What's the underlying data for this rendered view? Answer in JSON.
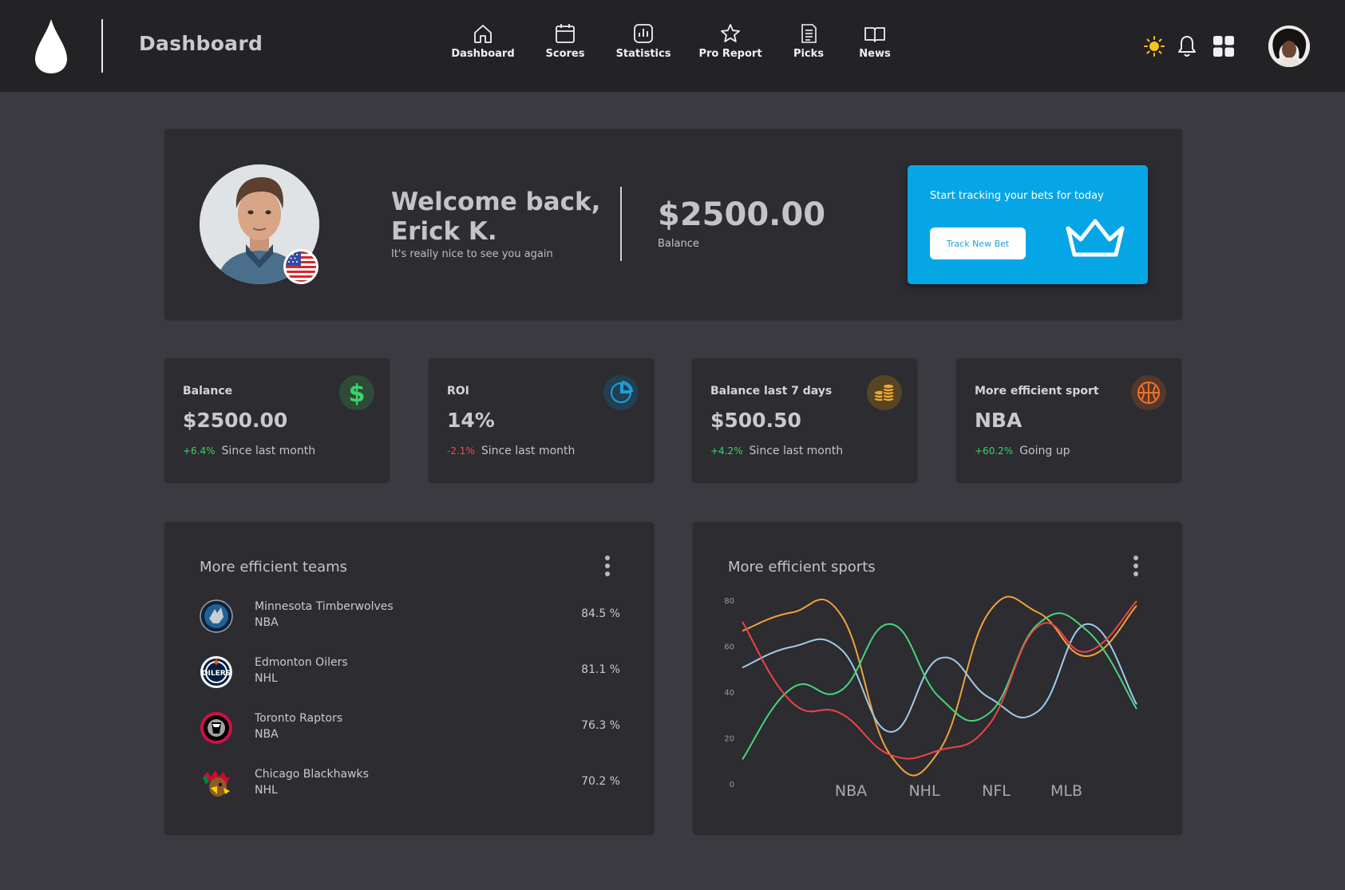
{
  "header": {
    "title": "Dashboard",
    "nav": [
      {
        "label": "Dashboard",
        "icon": "home-icon"
      },
      {
        "label": "Scores",
        "icon": "calendar-icon"
      },
      {
        "label": "Statistics",
        "icon": "bar-chart-icon"
      },
      {
        "label": "Pro Report",
        "icon": "star-icon"
      },
      {
        "label": "Picks",
        "icon": "document-icon"
      },
      {
        "label": "News",
        "icon": "book-icon"
      }
    ],
    "right_icons": [
      "sun-icon",
      "bell-icon",
      "apps-grid-icon"
    ]
  },
  "welcome": {
    "title": "Welcome back, Erick K.",
    "subtitle": "It's really nice to see you again",
    "balance": "$2500.00",
    "balance_label": "Balance",
    "cta_text": "Start tracking your bets for today",
    "cta_button": "Track New Bet"
  },
  "stats": [
    {
      "label": "Balance",
      "value": "$2500.00",
      "change": "+6.4%",
      "note": "Since last month",
      "icon": "dollar-icon",
      "color": "#39d36b"
    },
    {
      "label": "ROI",
      "value": "14%",
      "change": "-2.1%",
      "note": "Since last month",
      "icon": "pie-chart-icon",
      "color": "#1f9fdc"
    },
    {
      "label": "Balance last 7 days",
      "value": "$500.50",
      "change": "+4.2%",
      "note": "Since last month",
      "icon": "coins-icon",
      "color": "#f0a92b"
    },
    {
      "label": "More efficient sport",
      "value": "NBA",
      "change": "+60.2%",
      "note": "Going up",
      "icon": "basketball-icon",
      "color": "#f0702b"
    }
  ],
  "teams_panel": {
    "title": "More efficient teams",
    "teams": [
      {
        "name": "Minnesota Timberwolves",
        "league": "NBA",
        "pct": "84.5 %"
      },
      {
        "name": "Edmonton Oilers",
        "league": "NHL",
        "pct": "81.1 %"
      },
      {
        "name": "Toronto Raptors",
        "league": "NBA",
        "pct": "76.3 %"
      },
      {
        "name": "Chicago Blackhawks",
        "league": "NHL",
        "pct": "70.2 %"
      }
    ]
  },
  "sports_panel": {
    "title": "More efficient sports"
  },
  "chart_data": {
    "type": "line",
    "title": "More efficient sports",
    "categories": [
      "NBA",
      "NHL",
      "NFL",
      "MLB"
    ],
    "y_ticks": [
      0,
      20,
      40,
      60,
      80
    ],
    "ylim": [
      0,
      80
    ],
    "grid": false,
    "legend": "none",
    "x": [
      0,
      1,
      2,
      3,
      4,
      5,
      6,
      7,
      8
    ],
    "series": [
      {
        "color": "#f0a23a",
        "values": [
          67,
          75,
          74,
          13,
          15,
          75,
          75,
          56,
          78
        ]
      },
      {
        "color": "#9fcbe9",
        "values": [
          51,
          60,
          59,
          23,
          55,
          38,
          32,
          70,
          35
        ]
      },
      {
        "color": "#49d47a",
        "values": [
          11,
          42,
          41,
          70,
          38,
          31,
          70,
          67,
          33
        ]
      },
      {
        "color": "#ef4444",
        "values": [
          71,
          36,
          31,
          13,
          15,
          26,
          69,
          58,
          80
        ]
      }
    ]
  },
  "colors": {
    "background": "#3a3a40",
    "topbar": "#232326",
    "panel": "#2c2c31",
    "accent": "#06a6e6"
  }
}
